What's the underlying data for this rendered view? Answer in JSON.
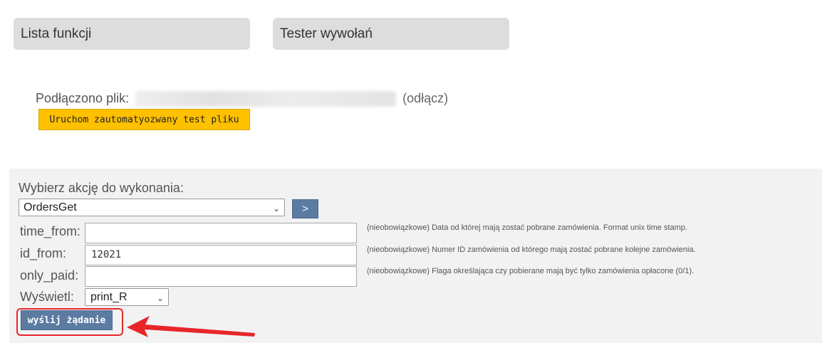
{
  "tabs": {
    "functions": "Lista funkcji",
    "tester": "Tester wywołań"
  },
  "connection": {
    "label": "Podłączono plik:",
    "disconnect": "(odłącz)"
  },
  "run_test_button": "Uruchom zautomatyozwany test pliku",
  "action": {
    "label": "Wybierz akcję do wykonania:",
    "selected": "OrdersGet",
    "go_button": ">"
  },
  "params": [
    {
      "name": "time_from:",
      "value": "",
      "description": "(nieobowiązkowe) Data od której mają zostać pobrane zamówienia. Format unix time stamp."
    },
    {
      "name": "id_from:",
      "value": "12021",
      "description": "(nieobowiązkowe) Numer ID zamówienia od którego mają zostać pobrane kolejne zamówienia."
    },
    {
      "name": "only_paid:",
      "value": "",
      "description": "(nieobowiązkowe) Flaga określająca czy pobierane mają być tylko zamówienia opłacone (0/1)."
    }
  ],
  "display": {
    "label": "Wyświetl:",
    "selected": "print_R"
  },
  "send_button": "wyślij żądanie",
  "colors": {
    "tab_bg": "#dddddd",
    "panel_bg": "#f2f2f2",
    "accent_yellow": "#ffc000",
    "button_blue": "#5b7ba1",
    "annotation_red": "#e8262a"
  }
}
